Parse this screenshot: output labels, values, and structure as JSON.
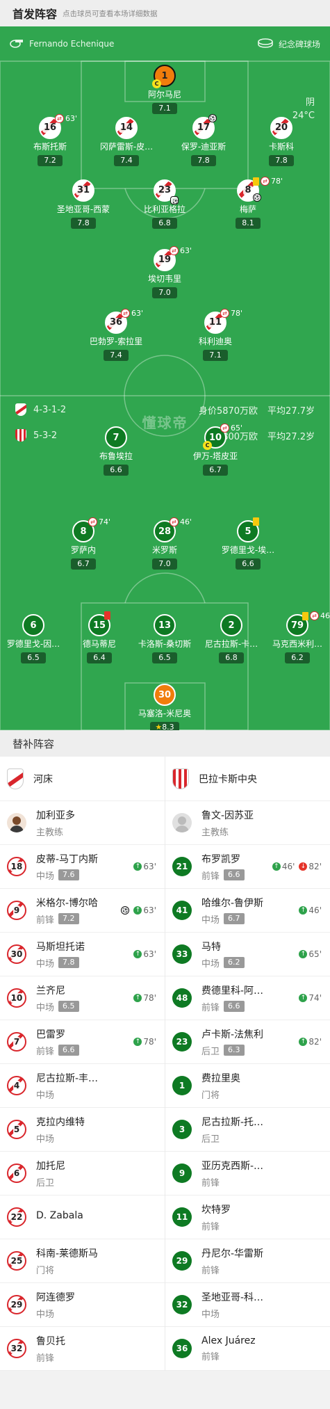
{
  "header": {
    "title": "首发阵容",
    "subtitle": "点击球员可查看本场详细数据"
  },
  "pitch": {
    "referee": "Fernando Echenique",
    "stadium": "纪念碑球场",
    "weather": "阴",
    "temperature": "24°C",
    "watermark": "懂球帝",
    "home_team": {
      "formation": "4-3-1-2",
      "value": "身价5870万欧",
      "avg_age": "平均27.7岁"
    },
    "away_team": {
      "formation": "5-3-2",
      "value": "身价800万欧",
      "avg_age": "平均27.2岁"
    },
    "home_players": [
      {
        "no": "1",
        "name": "阿尔马尼",
        "rating": "7.1",
        "gk": true,
        "captain": true
      },
      {
        "no": "16",
        "name": "布斯托斯",
        "rating": "7.2",
        "sub_out": "63'"
      },
      {
        "no": "14",
        "name": "冈萨雷斯-皮…",
        "rating": "7.4"
      },
      {
        "no": "17",
        "name": "保罗-迪亚斯",
        "rating": "7.8",
        "goal": true
      },
      {
        "no": "20",
        "name": "卡斯科",
        "rating": "7.8"
      },
      {
        "no": "31",
        "name": "圣地亚哥-西蒙",
        "rating": "7.8"
      },
      {
        "no": "23",
        "name": "比利亚格拉",
        "rating": "6.8",
        "og": true
      },
      {
        "no": "8",
        "name": "梅萨",
        "rating": "8.1",
        "yellow": true,
        "sub_out": "78'",
        "goal": true
      },
      {
        "no": "19",
        "name": "埃切韦里",
        "rating": "7.0",
        "sub_out": "63'"
      },
      {
        "no": "36",
        "name": "巴勃罗-索拉里",
        "rating": "7.4",
        "sub_out": "63'"
      },
      {
        "no": "11",
        "name": "科利迪奥",
        "rating": "7.1",
        "sub_out": "78'"
      }
    ],
    "away_players": [
      {
        "no": "7",
        "name": "布鲁埃拉",
        "rating": "6.6"
      },
      {
        "no": "10",
        "name": "伊万-塔皮亚",
        "rating": "6.7",
        "captain": true,
        "sub_out": "65'"
      },
      {
        "no": "8",
        "name": "罗萨内",
        "rating": "6.7",
        "sub_out": "74'"
      },
      {
        "no": "28",
        "name": "米罗斯",
        "rating": "7.0",
        "sub_out": "46'"
      },
      {
        "no": "5",
        "name": "罗德里戈-埃…",
        "rating": "6.6",
        "yellow": true
      },
      {
        "no": "6",
        "name": "罗德里戈-因…",
        "rating": "6.5"
      },
      {
        "no": "15",
        "name": "德马蒂尼",
        "rating": "6.4",
        "red": true
      },
      {
        "no": "13",
        "name": "卡洛斯-桑切斯",
        "rating": "6.5"
      },
      {
        "no": "2",
        "name": "尼古拉斯-卡…",
        "rating": "6.8"
      },
      {
        "no": "79",
        "name": "马克西米利…",
        "rating": "6.2",
        "yellow": true,
        "sub_out": "46'"
      },
      {
        "no": "30",
        "name": "马塞洛-米尼奥",
        "rating": "8.3",
        "gk": true,
        "best": true
      }
    ]
  },
  "bench": {
    "title": "替补阵容",
    "home": {
      "team": "河床",
      "coach": {
        "name": "加利亚多",
        "role": "主教练"
      },
      "players": [
        {
          "no": "18",
          "name": "皮蒂-马丁内斯",
          "pos": "中场",
          "rating": "7.6",
          "in": "63'"
        },
        {
          "no": "9",
          "name": "米格尔-博尔哈",
          "pos": "前锋",
          "rating": "7.2",
          "in": "63'",
          "goal": true
        },
        {
          "no": "30",
          "name": "马斯坦托诺",
          "pos": "中场",
          "rating": "7.8",
          "in": "63'"
        },
        {
          "no": "10",
          "name": "兰齐尼",
          "pos": "中场",
          "rating": "6.5",
          "in": "78'"
        },
        {
          "no": "7",
          "name": "巴雷罗",
          "pos": "前锋",
          "rating": "6.6",
          "in": "78'"
        },
        {
          "no": "4",
          "name": "尼古拉斯-丰…",
          "pos": "中场"
        },
        {
          "no": "5",
          "name": "克拉内维特",
          "pos": "中场"
        },
        {
          "no": "6",
          "name": "加托尼",
          "pos": "后卫"
        },
        {
          "no": "22",
          "name": "D. Zabala",
          "pos": ""
        },
        {
          "no": "25",
          "name": "科南-莱德斯马",
          "pos": "门将"
        },
        {
          "no": "29",
          "name": "阿连德罗",
          "pos": "中场"
        },
        {
          "no": "32",
          "name": "鲁贝托",
          "pos": "前锋"
        }
      ]
    },
    "away": {
      "team": "巴拉卡斯中央",
      "coach": {
        "name": "鲁文-因苏亚",
        "role": "主教练"
      },
      "players": [
        {
          "no": "21",
          "name": "布罗凯罗",
          "pos": "前锋",
          "rating": "6.6",
          "in": "46'",
          "out": "82'"
        },
        {
          "no": "41",
          "name": "哈维尔-鲁伊斯",
          "pos": "中场",
          "rating": "6.7",
          "in": "46'"
        },
        {
          "no": "33",
          "name": "马特",
          "pos": "中场",
          "rating": "6.2",
          "in": "65'"
        },
        {
          "no": "48",
          "name": "费德里科-阿…",
          "pos": "前锋",
          "rating": "6.6",
          "in": "74'"
        },
        {
          "no": "23",
          "name": "卢卡斯-法焦利",
          "pos": "后卫",
          "rating": "6.3",
          "in": "82'"
        },
        {
          "no": "1",
          "name": "费拉里奥",
          "pos": "门将"
        },
        {
          "no": "3",
          "name": "尼古拉斯-托…",
          "pos": "后卫"
        },
        {
          "no": "9",
          "name": "亚历克西斯-…",
          "pos": "前锋"
        },
        {
          "no": "11",
          "name": "坎特罗",
          "pos": "前锋"
        },
        {
          "no": "29",
          "name": "丹尼尔-华雷斯",
          "pos": "前锋"
        },
        {
          "no": "32",
          "name": "圣地亚哥-科…",
          "pos": "中场"
        },
        {
          "no": "36",
          "name": "Alex Juárez",
          "pos": "前锋"
        }
      ]
    }
  }
}
